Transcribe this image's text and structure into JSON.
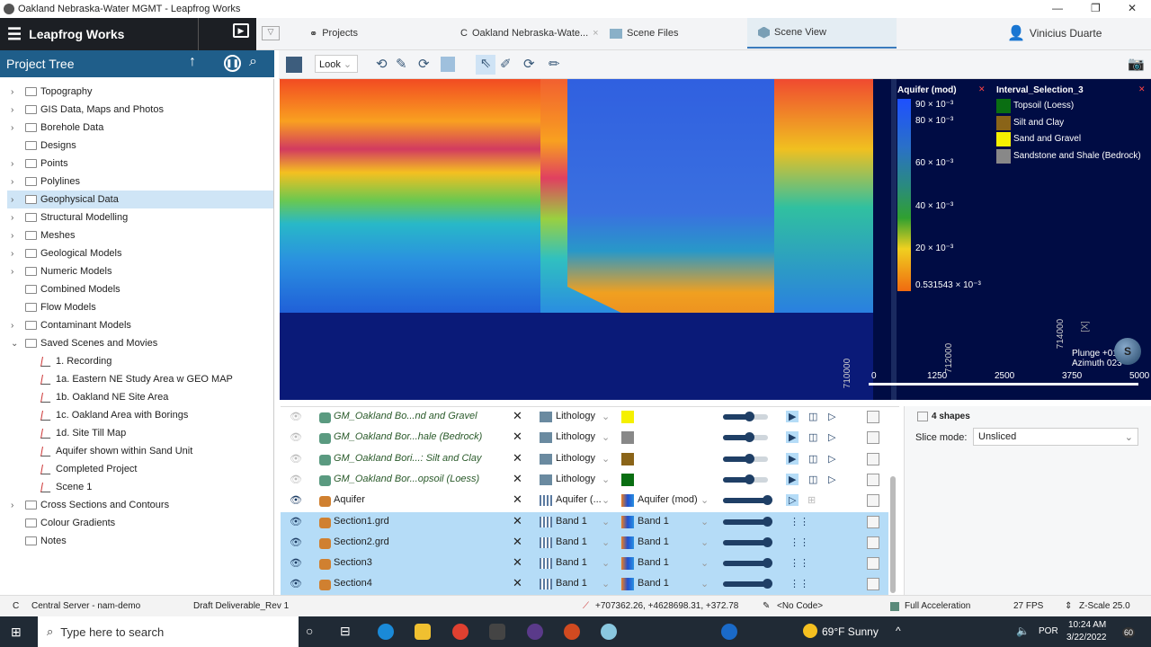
{
  "window": {
    "title": "Oakland Nebraska-Water MGMT - Leapfrog Works",
    "min": "—",
    "max": "❐",
    "close": "✕"
  },
  "brand": {
    "name": "Leapfrog Works"
  },
  "tabs": [
    {
      "label": "Projects"
    },
    {
      "label": "Oakland Nebraska-Wate..."
    },
    {
      "label": "Scene Files"
    },
    {
      "label": "Scene View"
    }
  ],
  "user": {
    "name": "Vinicius Duarte"
  },
  "project_tree": {
    "title": "Project Tree",
    "items": [
      {
        "label": "Topography",
        "expandable": true
      },
      {
        "label": "GIS Data, Maps and Photos",
        "expandable": true
      },
      {
        "label": "Borehole Data",
        "expandable": true
      },
      {
        "label": "Designs",
        "expandable": false
      },
      {
        "label": "Points",
        "expandable": true
      },
      {
        "label": "Polylines",
        "expandable": true
      },
      {
        "label": "Geophysical Data",
        "expandable": true,
        "selected": true
      },
      {
        "label": "Structural Modelling",
        "expandable": true
      },
      {
        "label": "Meshes",
        "expandable": true
      },
      {
        "label": "Geological Models",
        "expandable": true
      },
      {
        "label": "Numeric Models",
        "expandable": true
      },
      {
        "label": "Combined Models",
        "expandable": false
      },
      {
        "label": "Flow Models",
        "expandable": false
      },
      {
        "label": "Contaminant Models",
        "expandable": true
      },
      {
        "label": "Saved Scenes and Movies",
        "expanded": true
      }
    ],
    "scenes": [
      "1. Recording",
      "1a. Eastern NE Study Area w GEO MAP",
      "1b. Oakland NE Site Area",
      "1c. Oakland Area with Borings",
      "1d. Site Till Map",
      "Aquifer shown within Sand Unit",
      "Completed Project",
      "Scene 1"
    ],
    "after": [
      {
        "label": "Cross Sections and Contours",
        "expandable": true
      },
      {
        "label": "Colour Gradients",
        "expandable": false
      },
      {
        "label": "Notes",
        "expandable": false
      }
    ]
  },
  "toolbar": {
    "mode": "Look"
  },
  "legend_aquifer": {
    "title": "Aquifer (mod)",
    "ticks": [
      "90 × 10⁻³",
      "80 × 10⁻³",
      "60 × 10⁻³",
      "40 × 10⁻³",
      "20 × 10⁻³",
      "0.531543 × 10⁻³"
    ]
  },
  "legend_interval": {
    "title": "Interval_Selection_3",
    "items": [
      {
        "label": "Topsoil (Loess)",
        "color": "#0a6e12"
      },
      {
        "label": "Silt and Clay",
        "color": "#8a6418"
      },
      {
        "label": "Sand and Gravel",
        "color": "#f5f000"
      },
      {
        "label": "Sandstone and Shale (Bedrock)",
        "color": "#888888"
      }
    ]
  },
  "scene": {
    "plunge": "Plunge +01",
    "azimuth": "Azimuth 023",
    "scale": [
      "0",
      "1250",
      "2500",
      "3750",
      "5000"
    ],
    "coords": [
      "712000",
      "714000",
      "710000"
    ],
    "compass": "S",
    "axis": "[X]"
  },
  "layers": [
    {
      "name": "GM_Oakland Bo...nd and Gravel",
      "visible": false,
      "column": "Lithology",
      "color": "#f5f000",
      "italic": true
    },
    {
      "name": "GM_Oakland Bor...hale (Bedrock)",
      "visible": false,
      "column": "Lithology",
      "color": "#888888",
      "italic": true
    },
    {
      "name": "GM_Oakland Bori...: Silt and Clay",
      "visible": false,
      "column": "Lithology",
      "color": "#8a6418",
      "italic": true
    },
    {
      "name": "GM_Oakland Bor...opsoil (Loess)",
      "visible": false,
      "column": "Lithology",
      "color": "#0a6e12",
      "italic": true
    },
    {
      "name": "Aquifer",
      "visible": true,
      "column": "Aquifer (...",
      "colormap": "Aquifer (mod)"
    },
    {
      "name": "Section1.grd",
      "visible": true,
      "column": "Band 1",
      "colormap": "Band 1",
      "selected": true
    },
    {
      "name": "Section2.grd",
      "visible": true,
      "column": "Band 1",
      "colormap": "Band 1",
      "selected": true
    },
    {
      "name": "Section3",
      "visible": true,
      "column": "Band 1",
      "colormap": "Band 1",
      "selected": true
    },
    {
      "name": "Section4",
      "visible": true,
      "column": "Band 1",
      "colormap": "Band 1",
      "selected": true
    }
  ],
  "properties": {
    "count": "4 shapes",
    "slice_label": "Slice mode:",
    "slice_value": "Unsliced"
  },
  "status": {
    "server": "Central Server - nam-demo",
    "branch": "Draft Deliverable_Rev 1",
    "coords": "+707362.26, +4628698.31, +372.78",
    "code": "<No Code>",
    "accel": "Full Acceleration",
    "fps": "27 FPS",
    "zscale": "Z-Scale 25.0"
  },
  "taskbar": {
    "search": "Type here to search",
    "weather": "69°F  Sunny",
    "lang": "POR",
    "time": "10:24 AM",
    "date": "3/22/2022",
    "notif": "60"
  }
}
